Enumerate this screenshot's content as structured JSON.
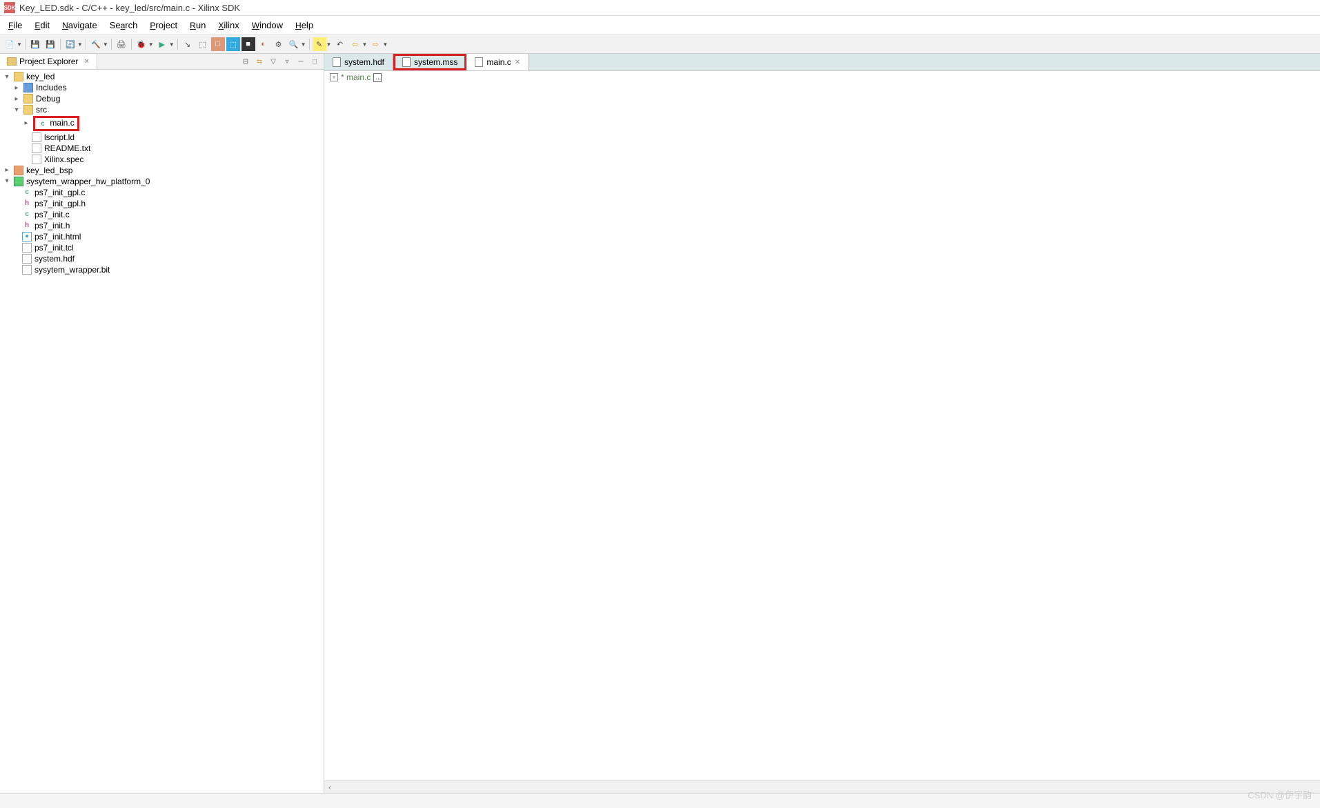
{
  "title": "Key_LED.sdk - C/C++ - key_led/src/main.c - Xilinx SDK",
  "menu": {
    "file": "File",
    "edit": "Edit",
    "navigate": "Navigate",
    "search": "Search",
    "project": "Project",
    "run": "Run",
    "xilinx": "Xilinx",
    "window": "Window",
    "help": "Help"
  },
  "project_explorer": {
    "title": "Project Explorer",
    "tree": {
      "key_led": "key_led",
      "includes": "Includes",
      "debug": "Debug",
      "src": "src",
      "main_c": "main.c",
      "lscript": "lscript.ld",
      "readme": "README.txt",
      "xilinx_spec": "Xilinx.spec",
      "key_led_bsp": "key_led_bsp",
      "sysytem_wrapper": "sysytem_wrapper_hw_platform_0",
      "ps7_init_gpl_c": "ps7_init_gpl.c",
      "ps7_init_gpl_h": "ps7_init_gpl.h",
      "ps7_init_c": "ps7_init.c",
      "ps7_init_h": "ps7_init.h",
      "ps7_init_html": "ps7_init.html",
      "ps7_init_tcl": "ps7_init.tcl",
      "system_hdf": "system.hdf",
      "sysytem_wrapper_bit": "sysytem_wrapper.bit"
    }
  },
  "editor_tabs": {
    "system_hdf": "system.hdf",
    "system_mss": "system.mss",
    "main_c": "main.c"
  },
  "editor_content": {
    "line1": "* main.c"
  },
  "watermark": "CSDN @伊宇韵"
}
